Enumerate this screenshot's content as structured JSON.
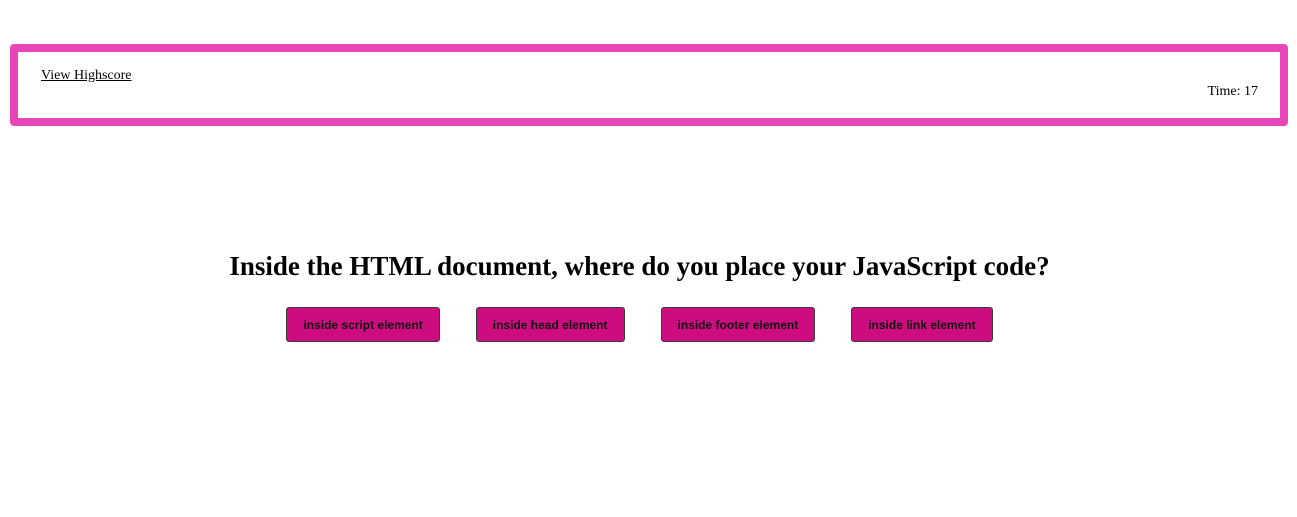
{
  "header": {
    "highscore_link_label": "View Highscore",
    "timer_text": "Time: 17"
  },
  "quiz": {
    "question": "Inside the HTML document, where do you place your JavaScript code?",
    "choices": [
      "inside script element",
      "inside head element",
      "inside footer element",
      "inside link element"
    ]
  },
  "colors": {
    "header_border": "#e845b8",
    "button_background": "#cc0c7f"
  }
}
